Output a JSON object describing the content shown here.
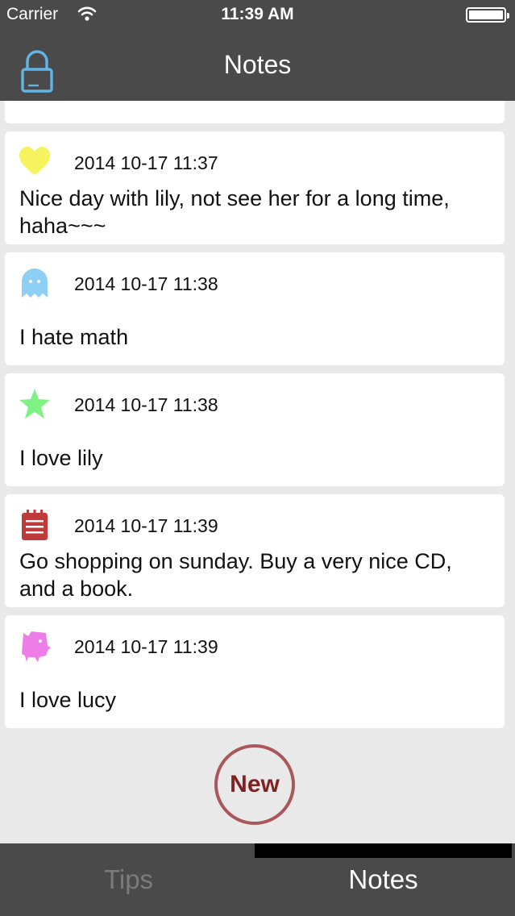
{
  "status_bar": {
    "carrier": "Carrier",
    "time": "11:39 AM",
    "wifi_icon": "wifi-icon",
    "battery_icon": "battery-icon"
  },
  "nav_bar": {
    "title": "Notes",
    "lock_icon": "lock-icon",
    "lock_color": "#5fb6e6",
    "background": "#4a4a4a"
  },
  "notes": [
    {
      "icon": "heart-icon",
      "icon_color": "#f5f35e",
      "date": "2014 10-17 11:37",
      "text": "Nice day with lily, not see her for a long time, haha~~~"
    },
    {
      "icon": "ghost-icon",
      "icon_color": "#8ecff5",
      "date": "2014 10-17 11:38",
      "text": "I hate math"
    },
    {
      "icon": "star-icon",
      "icon_color": "#7ef284",
      "date": "2014 10-17 11:38",
      "text": "I love lily"
    },
    {
      "icon": "notepad-icon",
      "icon_color": "#c0393b",
      "date": "2014 10-17 11:39",
      "text": "Go shopping on sunday. Buy a very nice CD, and a book."
    },
    {
      "icon": "monster-icon",
      "icon_color": "#ef7de8",
      "date": "2014 10-17 11:39",
      "text": "I love lucy"
    }
  ],
  "new_button": {
    "label": "New",
    "color": "#a9575a"
  },
  "tab_bar": {
    "tabs": [
      {
        "label": "Tips",
        "selected": false
      },
      {
        "label": "Notes",
        "selected": true
      }
    ]
  }
}
